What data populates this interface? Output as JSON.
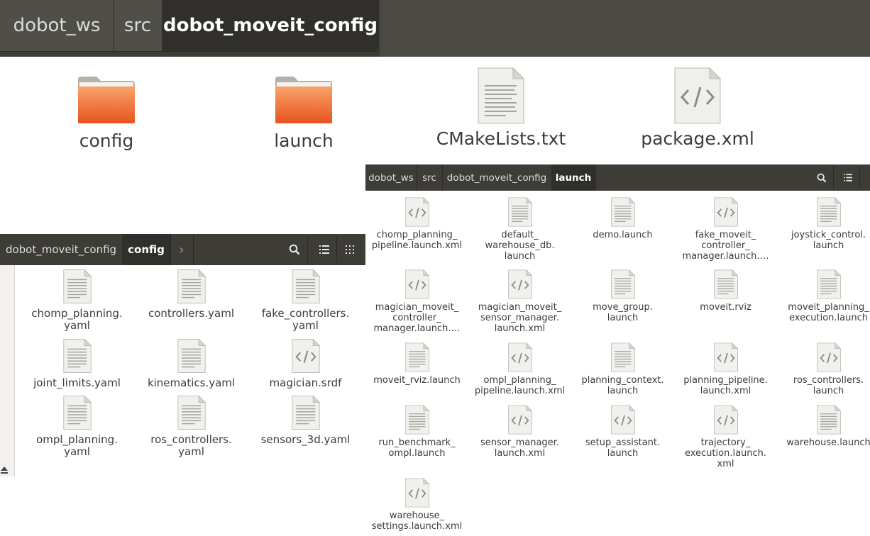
{
  "window_top": {
    "breadcrumb": [
      "dobot_ws",
      "src",
      "dobot_moveit_config"
    ],
    "items": [
      {
        "name": "config",
        "icon": "folder-icon"
      },
      {
        "name": "launch",
        "icon": "folder-icon"
      },
      {
        "name": "CMakeLists.txt",
        "icon": "text-file-icon"
      },
      {
        "name": "package.xml",
        "icon": "code-file-icon"
      }
    ]
  },
  "window_launch": {
    "breadcrumb": [
      "dobot_ws",
      "src",
      "dobot_moveit_config",
      "launch"
    ],
    "toolbar": {
      "search_icon": "search-icon",
      "list_icon": "list-view-icon"
    },
    "items": [
      {
        "name": "chomp_planning_\npipeline.launch.xml",
        "icon": "code-file-icon"
      },
      {
        "name": "default_\nwarehouse_db.\nlaunch",
        "icon": "text-file-icon"
      },
      {
        "name": "demo.launch",
        "icon": "text-file-icon"
      },
      {
        "name": "fake_moveit_\ncontroller_\nmanager.launch.…",
        "icon": "code-file-icon"
      },
      {
        "name": "joystick_control.\nlaunch",
        "icon": "text-file-icon"
      },
      {
        "name": "magician_moveit_\ncontroller_\nmanager.launch.…",
        "icon": "code-file-icon"
      },
      {
        "name": "magician_moveit_\nsensor_manager.\nlaunch.xml",
        "icon": "code-file-icon"
      },
      {
        "name": "move_group.\nlaunch",
        "icon": "text-file-icon"
      },
      {
        "name": "moveit.rviz",
        "icon": "text-file-icon"
      },
      {
        "name": "moveit_planning_\nexecution.launch",
        "icon": "text-file-icon"
      },
      {
        "name": "moveit_rviz.launch",
        "icon": "text-file-icon"
      },
      {
        "name": "ompl_planning_\npipeline.launch.xml",
        "icon": "code-file-icon"
      },
      {
        "name": "planning_context.\nlaunch",
        "icon": "text-file-icon"
      },
      {
        "name": "planning_pipeline.\nlaunch.xml",
        "icon": "code-file-icon"
      },
      {
        "name": "ros_controllers.\nlaunch",
        "icon": "code-file-icon"
      },
      {
        "name": "run_benchmark_\nompl.launch",
        "icon": "text-file-icon"
      },
      {
        "name": "sensor_manager.\nlaunch.xml",
        "icon": "code-file-icon"
      },
      {
        "name": "setup_assistant.\nlaunch",
        "icon": "code-file-icon"
      },
      {
        "name": "trajectory_\nexecution.launch.\nxml",
        "icon": "code-file-icon"
      },
      {
        "name": "warehouse.launch",
        "icon": "text-file-icon"
      },
      {
        "name": "warehouse_\nsettings.launch.xml",
        "icon": "code-file-icon"
      }
    ]
  },
  "window_config": {
    "breadcrumb": [
      "dobot_moveit_config",
      "config"
    ],
    "forward_glyph": "›",
    "toolbar": {
      "search_icon": "search-icon",
      "list_icon": "list-view-icon",
      "grid_icon": "grid-view-icon"
    },
    "sidebar": {
      "eject_icon": "eject-icon"
    },
    "items": [
      {
        "name": "chomp_planning.\nyaml",
        "icon": "text-file-icon"
      },
      {
        "name": "controllers.yaml",
        "icon": "text-file-icon"
      },
      {
        "name": "fake_controllers.\nyaml",
        "icon": "text-file-icon"
      },
      {
        "name": "joint_limits.yaml",
        "icon": "text-file-icon"
      },
      {
        "name": "kinematics.yaml",
        "icon": "text-file-icon"
      },
      {
        "name": "magician.srdf",
        "icon": "code-file-icon"
      },
      {
        "name": "ompl_planning.\nyaml",
        "icon": "text-file-icon"
      },
      {
        "name": "ros_controllers.\nyaml",
        "icon": "text-file-icon"
      },
      {
        "name": "sensors_3d.yaml",
        "icon": "text-file-icon"
      }
    ]
  }
}
